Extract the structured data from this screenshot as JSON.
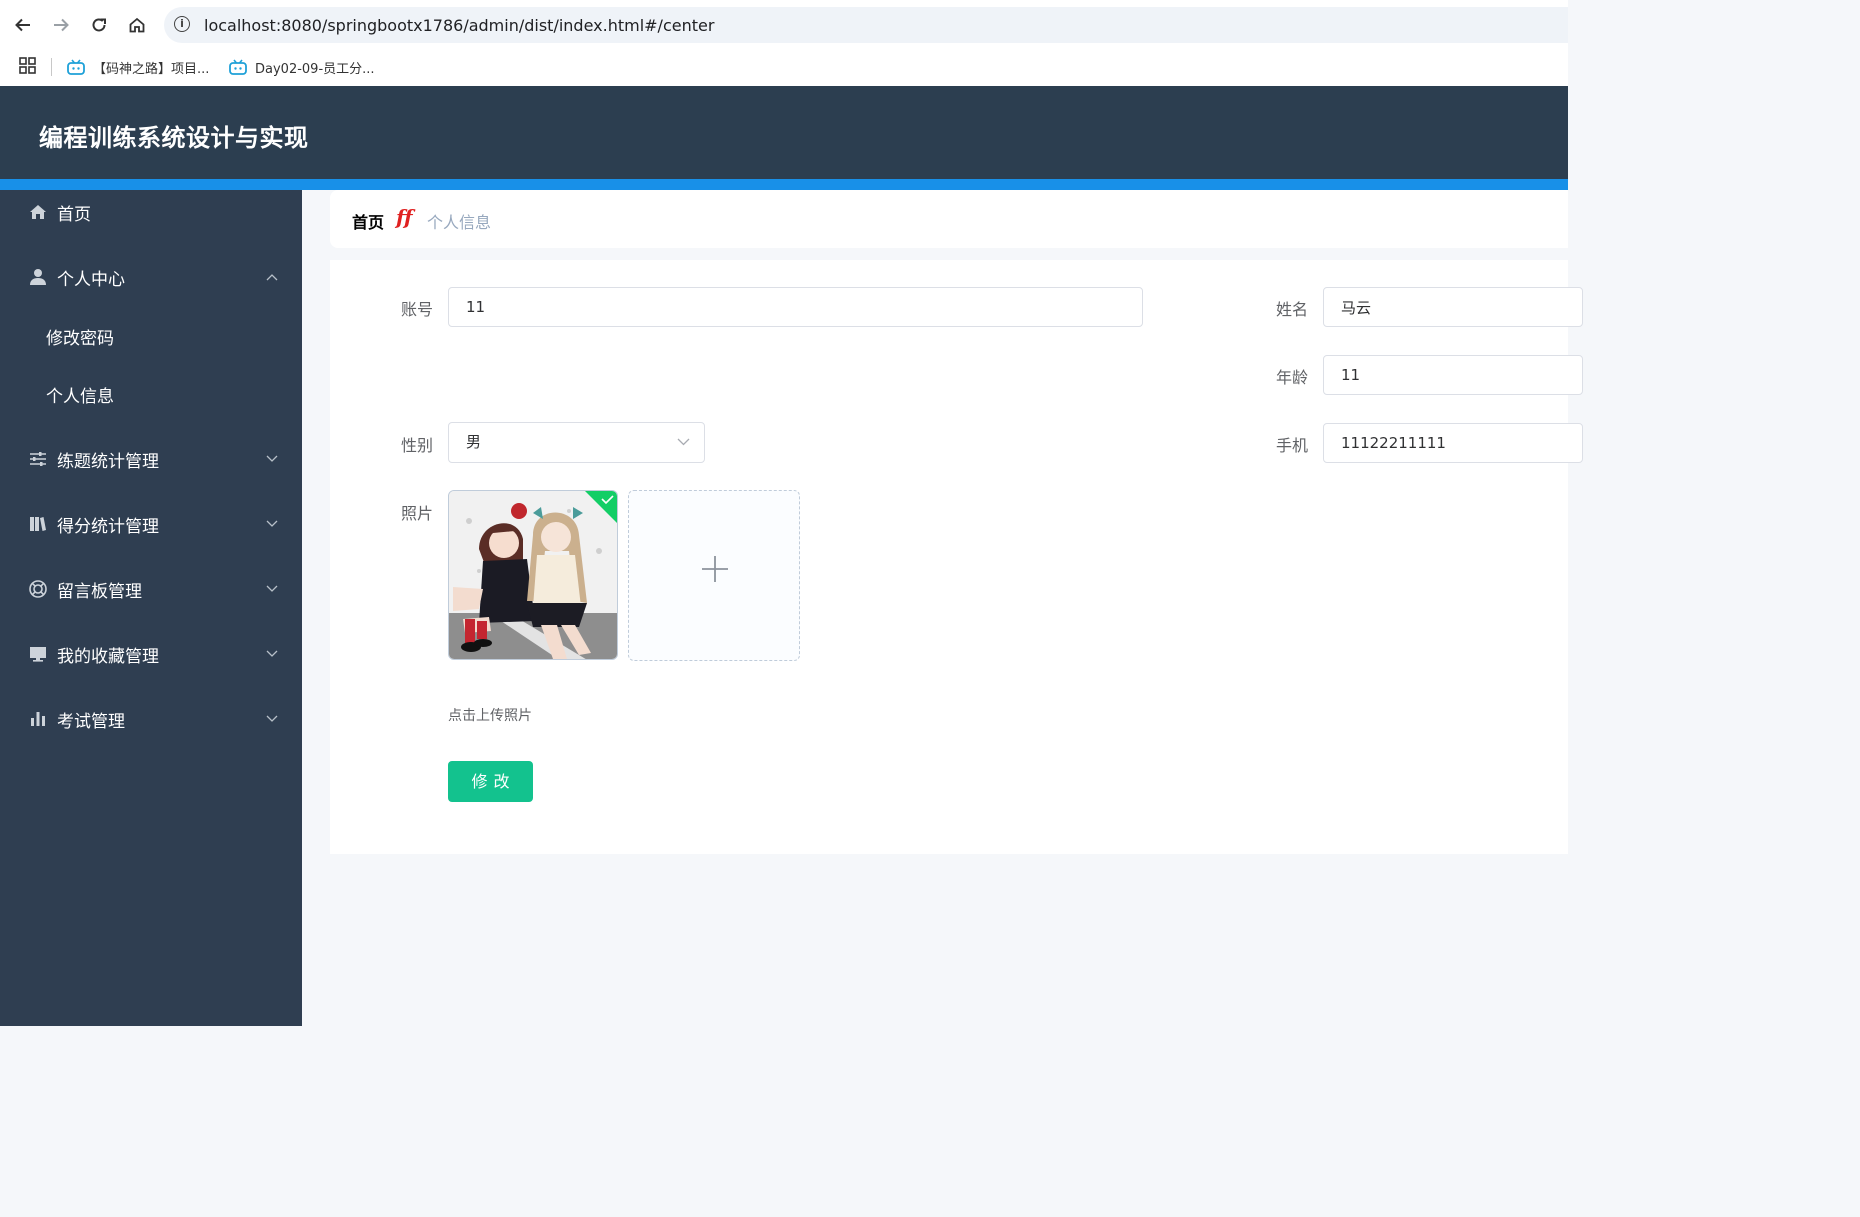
{
  "browser": {
    "url": "localhost:8080/springbootx1786/admin/dist/index.html#/center",
    "bookmarks": [
      {
        "label": "【码神之路】项目..."
      },
      {
        "label": "Day02-09-员工分..."
      }
    ]
  },
  "header": {
    "title": "编程训练系统设计与实现"
  },
  "sidebar": {
    "items": [
      {
        "label": "首页",
        "icon": "home-icon"
      },
      {
        "label": "个人中心",
        "icon": "user-icon",
        "expanded": true,
        "children": [
          {
            "label": "修改密码"
          },
          {
            "label": "个人信息"
          }
        ]
      },
      {
        "label": "练题统计管理",
        "icon": "sliders-icon"
      },
      {
        "label": "得分统计管理",
        "icon": "books-icon"
      },
      {
        "label": "留言板管理",
        "icon": "lifebuoy-icon"
      },
      {
        "label": "我的收藏管理",
        "icon": "monitor-icon"
      },
      {
        "label": "考试管理",
        "icon": "bar-chart-icon"
      }
    ]
  },
  "breadcrumb": {
    "home": "首页",
    "separator": "ff",
    "current": "个人信息"
  },
  "form": {
    "account": {
      "label": "账号",
      "value": "11"
    },
    "name": {
      "label": "姓名",
      "value": "马云"
    },
    "age": {
      "label": "年龄",
      "value": "11"
    },
    "gender": {
      "label": "性别",
      "value": "男"
    },
    "phone": {
      "label": "手机",
      "value": "11122211111"
    },
    "photo": {
      "label": "照片",
      "hint": "点击上传照片"
    },
    "submit_label": "修改"
  },
  "colors": {
    "header_bg": "#2c3e50",
    "accent_bar": "#1890e8",
    "sidebar_bg": "#2f3e51",
    "primary_button": "#13c28e",
    "upload_success": "#13ce66"
  }
}
